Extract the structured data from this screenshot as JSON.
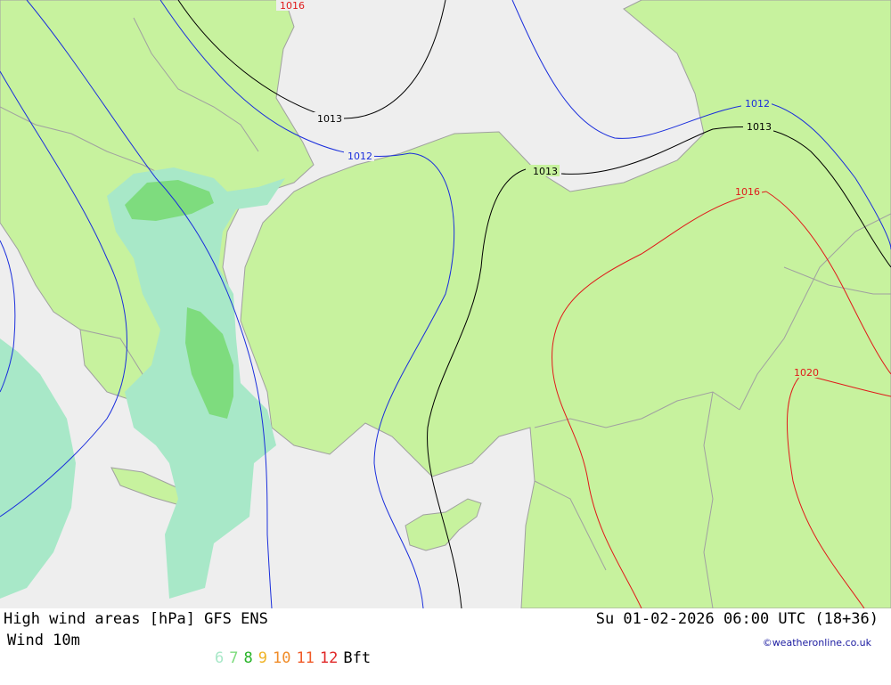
{
  "map": {
    "colors": {
      "sea": "#eeeeee",
      "land": "#c7f29e",
      "border": "#a0a0a0",
      "wind6": "#a8e8c8",
      "wind7": "#7edc7e",
      "isobar_low": "#1a2edc",
      "isobar_mid": "#000000",
      "isobar_high": "#e01a1a"
    },
    "isobar_labels": {
      "l1016_top": "1016",
      "l1013_a": "1013",
      "l1012_a": "1012",
      "l1012_b": "1012",
      "l1013_b": "1013",
      "l1013_c": "1013",
      "l1016_right": "1016",
      "l1020": "1020"
    }
  },
  "footer": {
    "title_left": "High wind areas [hPa] GFS ENS",
    "title_right": "Su 01-02-2026 06:00 UTC (18+36)",
    "legend_label": "Wind 10m",
    "bft_scale": [
      {
        "value": "6",
        "color": "#a8e8c8"
      },
      {
        "value": "7",
        "color": "#7edc7e"
      },
      {
        "value": "8",
        "color": "#28b428"
      },
      {
        "value": "9",
        "color": "#f0b428"
      },
      {
        "value": "10",
        "color": "#f08c28"
      },
      {
        "value": "11",
        "color": "#f05a28"
      },
      {
        "value": "12",
        "color": "#e02828"
      }
    ],
    "bft_unit": "Bft",
    "credit": "©weatheronline.co.uk"
  }
}
